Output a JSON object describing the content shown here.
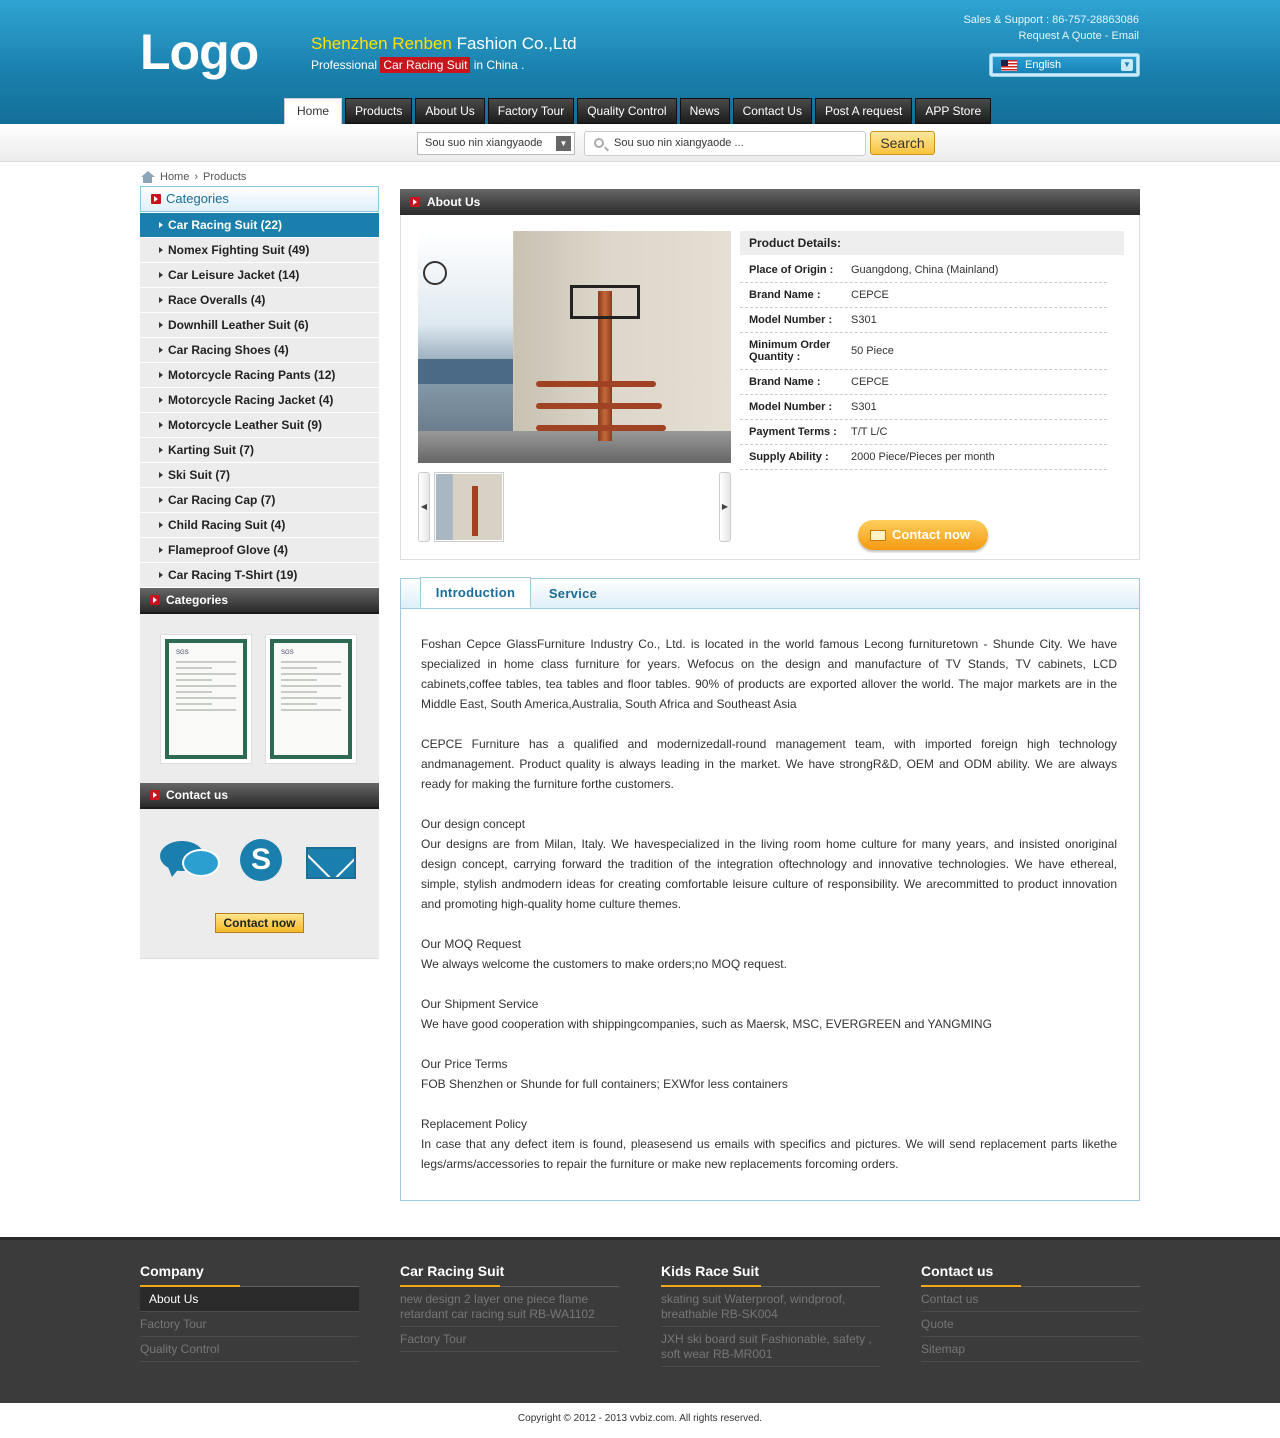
{
  "header": {
    "logo": "Logo",
    "company_yellow": "Shenzhen Renben",
    "company_rest": " Fashion Co.,Ltd",
    "tagline_pre": "Professional ",
    "tagline_highlight": "Car Racing Suit",
    "tagline_post": " in China .",
    "support": "Sales & Support : 86-757-28863086",
    "request_quote": "Request A Quote",
    "separator": "-",
    "email": "Email",
    "language": "English",
    "flag_icon": "us-flag-icon"
  },
  "nav": [
    "Home",
    "Products",
    "About Us",
    "Factory Tour",
    "Quality Control",
    "News",
    "Contact Us",
    "Post A request",
    "APP Store"
  ],
  "search": {
    "select_value": "Sou suo nin xiangyaode",
    "input_placeholder": "Sou suo nin xiangyaode ...",
    "button": "Search"
  },
  "breadcrumb": [
    "Home",
    "Products"
  ],
  "sidebar": {
    "categories_title": "Categories",
    "categories": [
      "Car Racing Suit (22)",
      "Nomex Fighting Suit (49)",
      "Car Leisure Jacket (14)",
      "Race Overalls (4)",
      "Downhill Leather Suit (6)",
      "Car Racing Shoes (4)",
      "Motorcycle Racing Pants (12)",
      "Motorcycle Racing Jacket (4)",
      "Motorcycle Leather Suit (9)",
      "Karting Suit (7)",
      "Ski Suit (7)",
      "Car Racing Cap (7)",
      "Child Racing Suit (4)",
      "Flameproof Glove (4)",
      "Car Racing T-Shirt (19)"
    ],
    "certs_title": "Categories",
    "cert_label": "SGS",
    "contact_title": "Contact us",
    "contact_button": "Contact now"
  },
  "about": {
    "title": "About Us",
    "details_title": "Product Details:",
    "details": [
      {
        "k": "Place of Origin :",
        "v": "Guangdong, China (Mainland)"
      },
      {
        "k": "Brand Name :",
        "v": "CEPCE"
      },
      {
        "k": "Model Number :",
        "v": "S301"
      },
      {
        "k": "Minimum Order Quantity :",
        "v": "50 Piece"
      },
      {
        "k": "Brand Name :",
        "v": "CEPCE"
      },
      {
        "k": "Model Number :",
        "v": "S301"
      },
      {
        "k": "Payment Terms :",
        "v": "T/T L/C"
      },
      {
        "k": "Supply Ability :",
        "v": "2000 Piece/Pieces per month"
      }
    ],
    "contact_button": "Contact now"
  },
  "tabs": [
    "Introduction",
    "Service"
  ],
  "intro": [
    "Foshan Cepce GlassFurniture Industry Co., Ltd. is located in the world famous Lecong furnituretown - Shunde City. We have specialized in home class furniture for years. Wefocus on the design and manufacture of TV Stands, TV cabinets, LCD cabinets,coffee tables, tea tables and floor tables. 90% of products are exported allover the world. The major markets are in the Middle East, South America,Australia, South Africa and Southeast Asia",
    "",
    "CEPCE Furniture has a qualified and modernizedall-round management team, with imported foreign high technology andmanagement. Product quality is always leading in the market. We have strongR&D, OEM and ODM ability. We are always ready for making the furniture forthe customers.",
    "",
    "Our design concept",
    "Our designs are from Milan, Italy. We havespecialized in the living room home culture for many years, and insisted onoriginal design concept, carrying forward the tradition of the integration oftechnology and innovative technologies. We have ethereal, simple, stylish andmodern ideas for creating comfortable leisure culture of responsibility. We arecommitted to product innovation and promoting high-quality home culture themes.",
    "",
    "Our MOQ Request",
    "We always welcome the customers to make orders;no MOQ request.",
    "",
    "Our Shipment Service",
    "We have good cooperation with shippingcompanies, such as Maersk, MSC, EVERGREEN and YANGMING",
    "",
    "Our Price Terms",
    "FOB Shenzhen or Shunde for full containers; EXWfor less containers",
    "",
    "Replacement Policy",
    "In case that any defect item is found, pleasesend us emails with specifics and pictures. We will send replacement parts likethe legs/arms/accessories to repair the furniture or make new replacements forcoming orders."
  ],
  "footer": {
    "cols": [
      {
        "title": "Company",
        "links": [
          "About Us",
          "Factory Tour",
          "Quality Control"
        ]
      },
      {
        "title": "Car Racing Suit",
        "links": [
          "new design 2 layer one piece flame retardant car racing suit RB-WA1102",
          "Factory Tour"
        ]
      },
      {
        "title": "Kids Race Suit",
        "links": [
          "skating suit Waterproof, windproof, breathable RB-SK004",
          "JXH ski board suit Fashionable, safety , soft wear RB-MR001"
        ]
      },
      {
        "title": "Contact us",
        "links": [
          "Contact us",
          "Quote",
          "Sitemap"
        ]
      }
    ],
    "copyright": "Copyright © 2012 - 2013 vvbiz.com. All rights reserved."
  },
  "colors": {
    "accent": "#1a7fac",
    "highlight": "#c8141c",
    "gold": "#f0a818"
  }
}
